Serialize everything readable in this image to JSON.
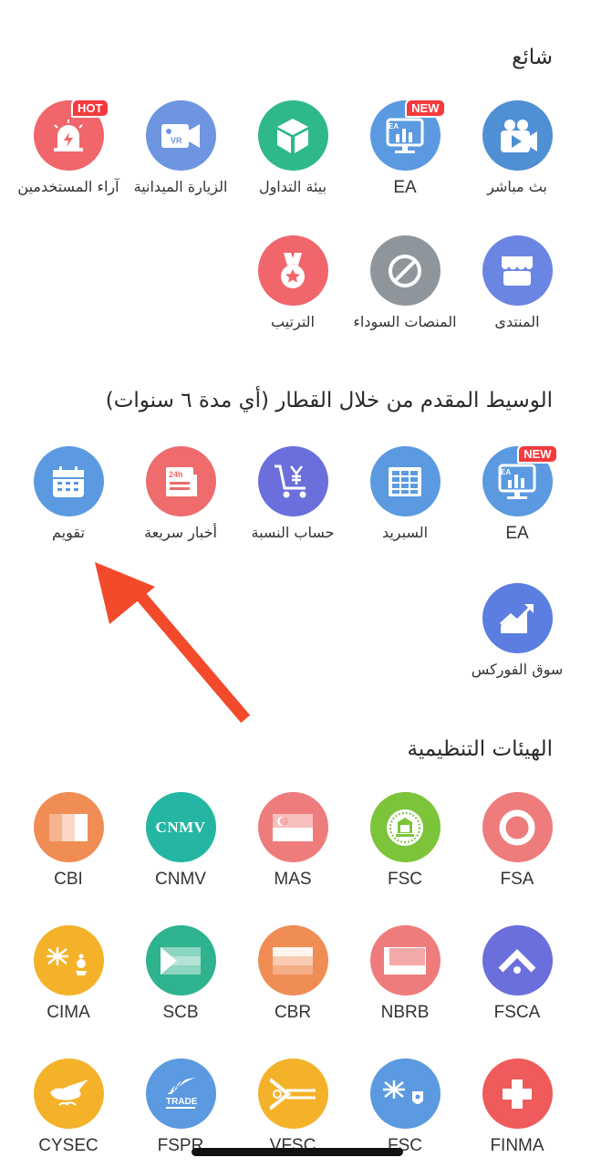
{
  "sections": {
    "popular": {
      "title": "شائع"
    },
    "broker": {
      "title": "الوسيط المقدم من خلال القطار (أي مدة ٦ سنوات)"
    },
    "regulators": {
      "title": "الهيئات التنظيمية"
    }
  },
  "popular": [
    {
      "label": "بث مباشر",
      "icon": "video-camera-icon",
      "color": "#4f8fd3"
    },
    {
      "label": "EA",
      "icon": "ea-monitor-icon",
      "color": "#5b9ae0",
      "badge": "NEW"
    },
    {
      "label": "بيئة التداول",
      "icon": "cube-icon",
      "color": "#2fb88a"
    },
    {
      "label": "الزيارة الميدانية",
      "icon": "vr-camera-icon",
      "color": "#6e95e0"
    },
    {
      "label": "آراء المستخدمين",
      "icon": "siren-icon",
      "color": "#f0666b",
      "badge": "HOT"
    },
    {
      "label": "المنتدى",
      "icon": "store-icon",
      "color": "#6a86e2"
    },
    {
      "label": "المنصات السوداء",
      "icon": "prohibited-icon",
      "color": "#8e969c"
    },
    {
      "label": "الترتيب",
      "icon": "medal-icon",
      "color": "#f0666b"
    }
  ],
  "broker": [
    {
      "label": "EA",
      "icon": "ea-monitor-icon",
      "color": "#5b9ae0",
      "badge": "NEW"
    },
    {
      "label": "السبريد",
      "icon": "grid-table-icon",
      "color": "#5b9ae0"
    },
    {
      "label": "حساب النسبة",
      "icon": "yen-cart-icon",
      "color": "#6a6fdc"
    },
    {
      "label": "أخبار سريعة",
      "icon": "newspaper-icon",
      "color": "#ee6c6c"
    },
    {
      "label": "تقويم",
      "icon": "calendar-icon",
      "color": "#5b9ae0"
    },
    {
      "label": "سوق الفوركس",
      "icon": "trend-chart-icon",
      "color": "#5b7ee0"
    }
  ],
  "regulators": [
    {
      "label": "FSA",
      "icon": "ring-icon",
      "color": "#ef7c7c"
    },
    {
      "label": "FSC",
      "icon": "belize-crest-icon",
      "color": "#7cc43a"
    },
    {
      "label": "MAS",
      "icon": "singapore-flag-icon",
      "color": "#ef7c7c"
    },
    {
      "label": "CNMV",
      "icon": "cnmv-logo-icon",
      "color": "#24b6a3",
      "logo_text": "CNMV"
    },
    {
      "label": "CBI",
      "icon": "ireland-flag-icon",
      "color": "#ef8d55"
    },
    {
      "label": "FSCA",
      "icon": "chevron-roof-icon",
      "color": "#6a6fdc"
    },
    {
      "label": "NBRB",
      "icon": "belarus-flag-icon",
      "color": "#ef7c7c"
    },
    {
      "label": "CBR",
      "icon": "russia-flag-icon",
      "color": "#ef8d55"
    },
    {
      "label": "SCB",
      "icon": "bahamas-flag-icon",
      "color": "#2fb38e"
    },
    {
      "label": "CIMA",
      "icon": "cayman-flag-icon",
      "color": "#f4b22a"
    },
    {
      "label": "FINMA",
      "icon": "swiss-cross-icon",
      "color": "#ef5a5a"
    },
    {
      "label": "FSC",
      "icon": "bvi-flag-icon",
      "color": "#5b9ae0"
    },
    {
      "label": "VFSC",
      "icon": "vanuatu-flag-icon",
      "color": "#f4b22a"
    },
    {
      "label": "FSPR",
      "icon": "fern-logo-icon",
      "color": "#5b9ae0",
      "logo_text": "TRADE"
    },
    {
      "label": "CYSEC",
      "icon": "cyprus-map-icon",
      "color": "#f4b22a"
    }
  ]
}
